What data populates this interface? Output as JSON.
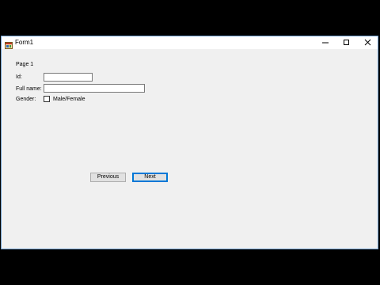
{
  "window": {
    "title": "Form1",
    "app_icon": "winforms-app-icon",
    "controls": {
      "minimize": "minimize-icon",
      "maximize": "maximize-icon",
      "close": "close-icon"
    }
  },
  "form": {
    "page_label": "Page 1",
    "id_label": "Id:",
    "id_value": "",
    "fullname_label": "Full name:",
    "fullname_value": "",
    "gender_label": "Gender:",
    "gender_checkbox_label": "Male/Female",
    "gender_checked": false
  },
  "buttons": {
    "previous_label": "Previous",
    "next_label": "Next"
  },
  "colors": {
    "window_border": "#6e9ecf",
    "form_background": "#f0f0f0",
    "default_button_border": "#0078d7"
  }
}
